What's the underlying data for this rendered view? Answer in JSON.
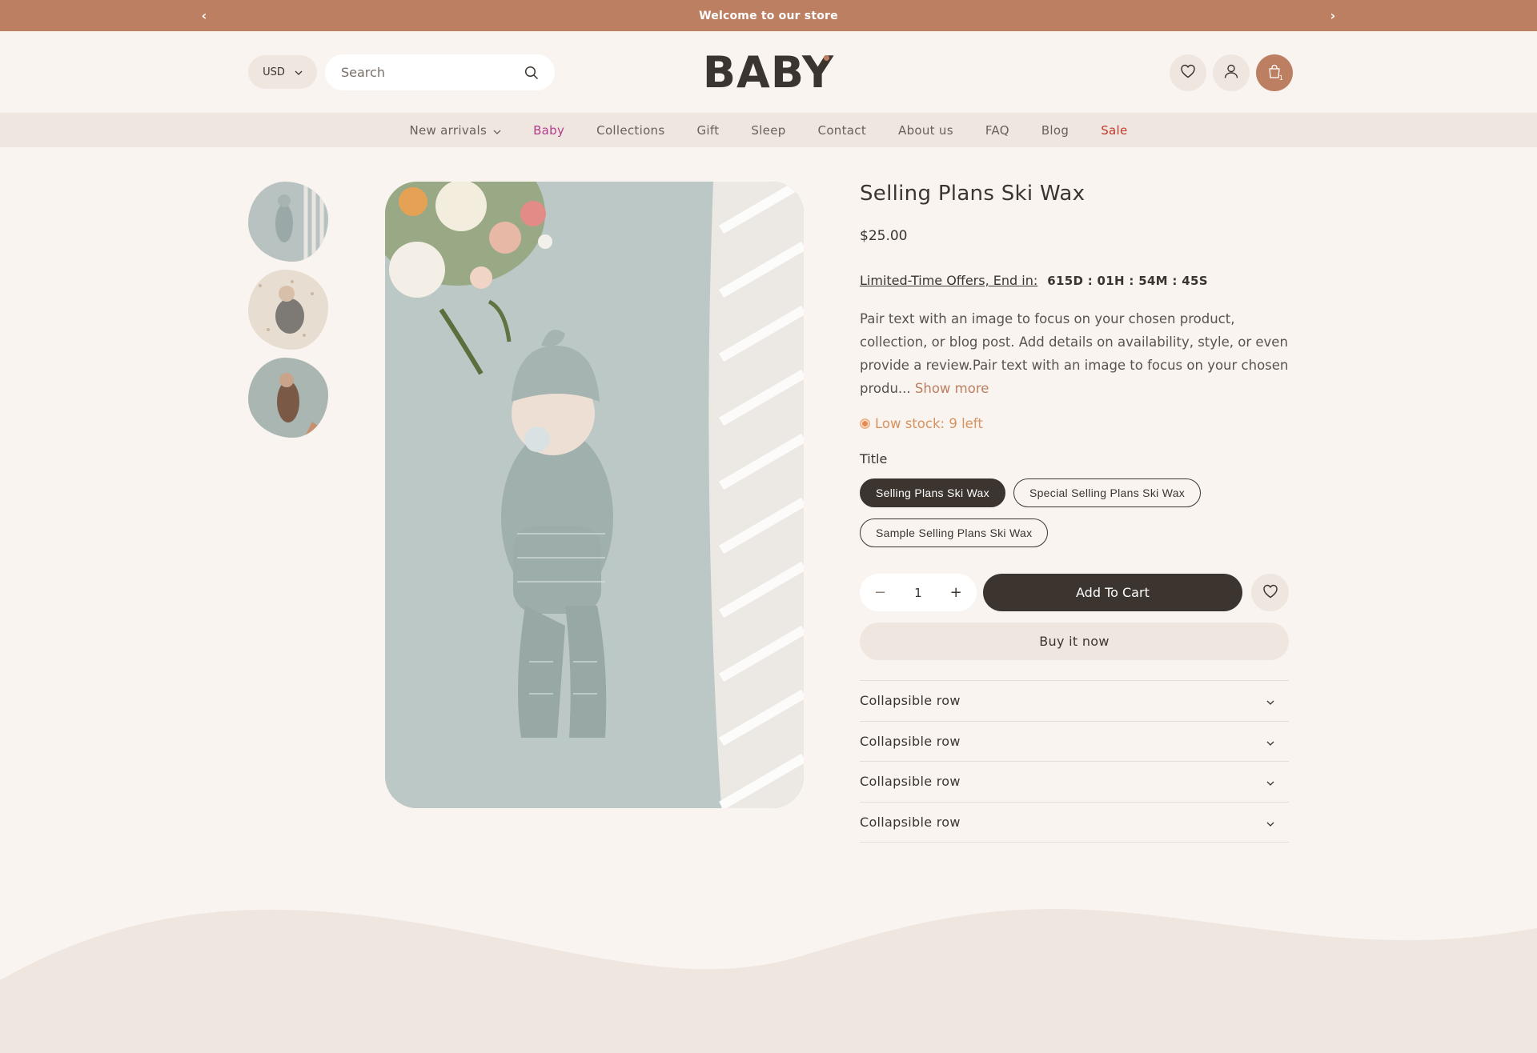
{
  "announcement": {
    "text": "Welcome to our store",
    "prev": "‹",
    "next": "›"
  },
  "header": {
    "currency": "USD",
    "search_placeholder": "Search",
    "logo": "BABY",
    "cart_count": "1"
  },
  "nav": {
    "items": [
      {
        "label": "New arrivals"
      },
      {
        "label": "Baby"
      },
      {
        "label": "Collections"
      },
      {
        "label": "Gift"
      },
      {
        "label": "Sleep"
      },
      {
        "label": "Contact"
      },
      {
        "label": "About us"
      },
      {
        "label": "FAQ"
      },
      {
        "label": "Blog"
      },
      {
        "label": "Sale"
      }
    ]
  },
  "product": {
    "title": "Selling Plans Ski Wax",
    "price": "$25.00",
    "offer_label": "Limited-Time Offers, End in:",
    "timer": "615D : 01H : 54M : 45S",
    "description": "Pair text with an image to focus on your chosen product, collection, or blog post. Add details on availability, style, or even provide a review.Pair text with an image to focus on your chosen produ...",
    "show_more": "Show more",
    "stock": "Low stock: 9 left",
    "option_label": "Title",
    "variants": [
      "Selling Plans Ski Wax",
      "Special Selling Plans Ski Wax",
      "Sample Selling Plans Ski Wax"
    ],
    "selected_variant": "Selling Plans Ski Wax",
    "quantity": "1",
    "qty_minus": "−",
    "qty_plus": "+",
    "add_to_cart": "Add To Cart",
    "buy_now": "Buy it now",
    "collapsible": [
      "Collapsible row",
      "Collapsible row",
      "Collapsible row",
      "Collapsible row"
    ]
  },
  "colors": {
    "accent": "#bc7f61",
    "dark": "#3b342f",
    "background": "#f9f4f0",
    "soft": "#efe6e0"
  }
}
